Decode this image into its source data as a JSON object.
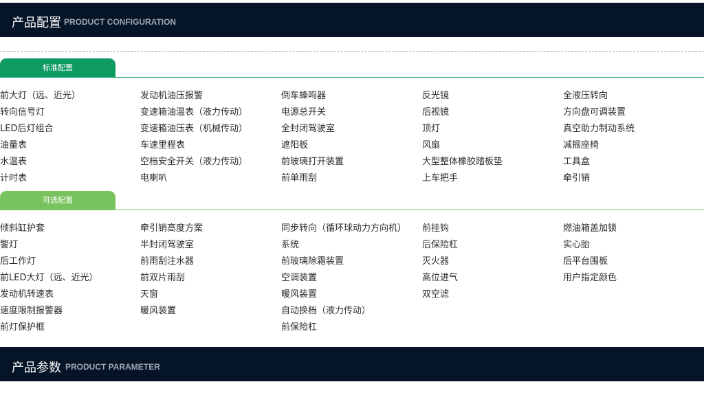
{
  "header_config": {
    "cn": "产品配置",
    "en": "PRODUCT CONFIGURATION"
  },
  "standard": {
    "tab_label": "标准配置",
    "columns": [
      [
        "前大灯（远、近光）",
        "转向信号灯",
        "LED后灯组合",
        "油量表",
        "水温表",
        "计时表"
      ],
      [
        "发动机油压报警",
        "变速箱油温表（液力传动）",
        "变速箱油压表（机械传动）",
        "车速里程表",
        "空档安全开关（液力传动）",
        "电喇叭"
      ],
      [
        "倒车蜂鸣器",
        "电源总开关",
        "全封闭驾驶室",
        "遮阳板",
        "前玻璃打开装置",
        "前单雨刮"
      ],
      [
        "反光镜",
        "后视镜",
        "顶灯",
        "风扇",
        "大型整体橡胶踏板垫",
        "上车把手"
      ],
      [
        "全液压转向",
        "方向盘可调装置",
        "真空助力制动系统",
        "减振座椅",
        "工具盒",
        "牵引销"
      ]
    ]
  },
  "optional": {
    "tab_label": "可选配置",
    "columns": [
      [
        "倾斜缸护套",
        "警灯",
        "后工作灯",
        "前LED大灯（远、近光）",
        "发动机转速表",
        "速度限制报警器",
        "前灯保护框"
      ],
      [
        "牵引销高度方案",
        "半封闭驾驶室",
        "前雨刮注水器",
        "前双片雨刮",
        "天窗",
        "暖风装置"
      ],
      [
        "同步转向（循环球动力方向机）",
        "系统",
        "前玻璃除霜装置",
        "空调装置",
        "暖风装置",
        "自动换档（液力传动）",
        "前保险杠"
      ],
      [
        "前挂钩",
        "后保险杠",
        "灭火器",
        "高位进气",
        "双空滤"
      ],
      [
        "燃油箱盖加锁",
        "实心胎",
        "后平台围板",
        "用户指定颜色"
      ]
    ]
  },
  "header_param": {
    "cn": "产品参数",
    "en": "PRODUCT PARAMETER"
  }
}
